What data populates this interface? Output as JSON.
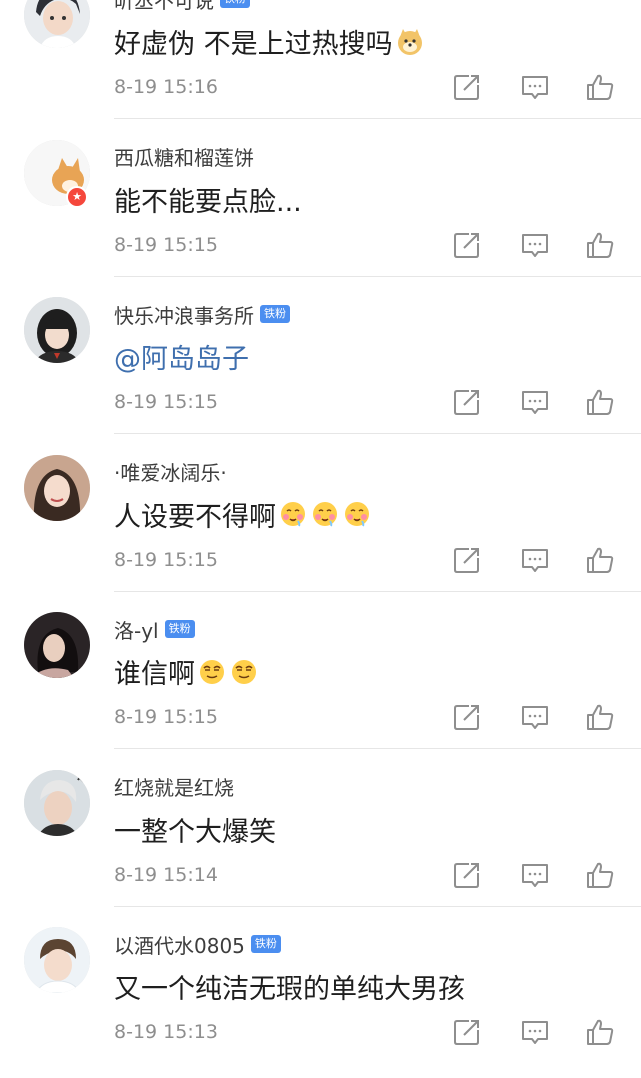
{
  "fan_badge_label": "铁粉",
  "verified_mark": "★",
  "colors": {
    "mention": "#3f6fae",
    "fan_badge": "#4b8ef0",
    "timestamp": "#8e8e8e",
    "verified_badge": "#f5473c"
  },
  "comments": [
    {
      "username": "昕丞不可说",
      "fan_badge": true,
      "verified": false,
      "text": "好虚伪 不是上过热搜吗",
      "emoji": [
        "doge-emoji"
      ],
      "is_mention": false,
      "timestamp": "8-19 15:16",
      "avatar": "anime-boy"
    },
    {
      "username": "西瓜糖和榴莲饼",
      "fan_badge": false,
      "verified": true,
      "text": "能不能要点脸...",
      "emoji": [],
      "is_mention": false,
      "timestamp": "8-19 15:15",
      "avatar": "shiba-dog"
    },
    {
      "username": "快乐冲浪事务所",
      "fan_badge": true,
      "verified": false,
      "text": "@阿岛岛子",
      "emoji": [],
      "is_mention": true,
      "timestamp": "8-19 15:15",
      "avatar": "girl-bangs"
    },
    {
      "username": "·唯爱冰阔乐·",
      "fan_badge": false,
      "verified": false,
      "text": "人设要不得啊",
      "emoji": [
        "drooling-face-emoji",
        "drooling-face-emoji",
        "drooling-face-emoji"
      ],
      "is_mention": false,
      "timestamp": "8-19 15:15",
      "avatar": "girl-long-hair"
    },
    {
      "username": "洛-yl",
      "fan_badge": true,
      "verified": false,
      "text": "谁信啊",
      "emoji": [
        "smirk-face-emoji",
        "smirk-face-emoji"
      ],
      "is_mention": false,
      "timestamp": "8-19 15:15",
      "avatar": "girl-dark"
    },
    {
      "username": "红烧就是红烧",
      "fan_badge": false,
      "verified": false,
      "text": "一整个大爆笑",
      "emoji": [],
      "is_mention": false,
      "timestamp": "8-19 15:14",
      "avatar": "boy-white-hair"
    },
    {
      "username": "以酒代水0805",
      "fan_badge": true,
      "verified": false,
      "text": "又一个纯洁无瑕的单纯大男孩",
      "emoji": [],
      "is_mention": false,
      "timestamp": "8-19 15:13",
      "avatar": "boy-bright"
    }
  ]
}
